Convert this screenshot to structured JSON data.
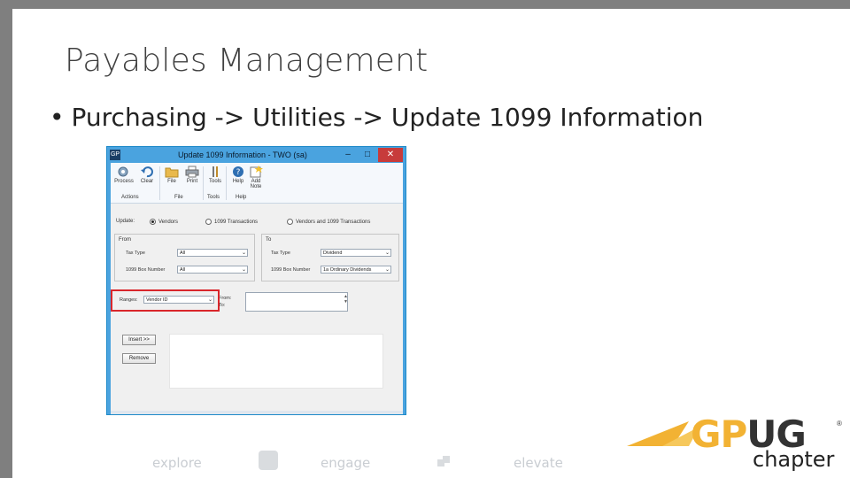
{
  "slide": {
    "title": "Payables Management",
    "bullet": "Purchasing -> Utilities -> Update 1099 Information"
  },
  "window": {
    "app_icon": "GP",
    "title": "Update 1099 Information - TWO (sa)",
    "controls": {
      "minimize": "–",
      "maximize": "□",
      "close": "✕"
    },
    "ribbon": {
      "buttons": [
        {
          "label": "Process",
          "icon": "process-gear-icon"
        },
        {
          "label": "Clear",
          "icon": "clear-undo-icon"
        },
        {
          "label": "File",
          "icon": "folder-icon"
        },
        {
          "label": "Print",
          "icon": "printer-icon"
        },
        {
          "label": "Tools",
          "icon": "tools-icon"
        },
        {
          "label": "Help",
          "icon": "help-icon"
        },
        {
          "label": "Add Note",
          "icon": "note-icon"
        }
      ],
      "groups": [
        "Actions",
        "File",
        "Tools",
        "Help"
      ]
    },
    "update_options": {
      "label": "Update:",
      "options": [
        "Vendors",
        "1099 Transactions",
        "Vendors and 1099 Transactions"
      ],
      "selected": "Vendors"
    },
    "from_group": {
      "label": "From",
      "tax_type_label": "Tax Type",
      "tax_type_value": "All",
      "box_label": "1099 Box Number",
      "box_value": "All"
    },
    "to_group": {
      "label": "To",
      "tax_type_label": "Tax Type",
      "tax_type_value": "Dividend",
      "box_label": "1099 Box Number",
      "box_value": "1a Ordinary Dividends"
    },
    "ranges": {
      "label": "Ranges:",
      "value": "Vendor ID",
      "from_label": "From:",
      "to_label": "To:"
    },
    "buttons": {
      "insert": "Insert >>",
      "remove": "Remove"
    }
  },
  "footer": {
    "words": [
      "explore",
      "engage",
      "elevate"
    ]
  },
  "logo": {
    "gp": "GP",
    "ug": "UG",
    "reg": "®",
    "chapter": "chapter",
    "brand_color": "#f2b233"
  }
}
